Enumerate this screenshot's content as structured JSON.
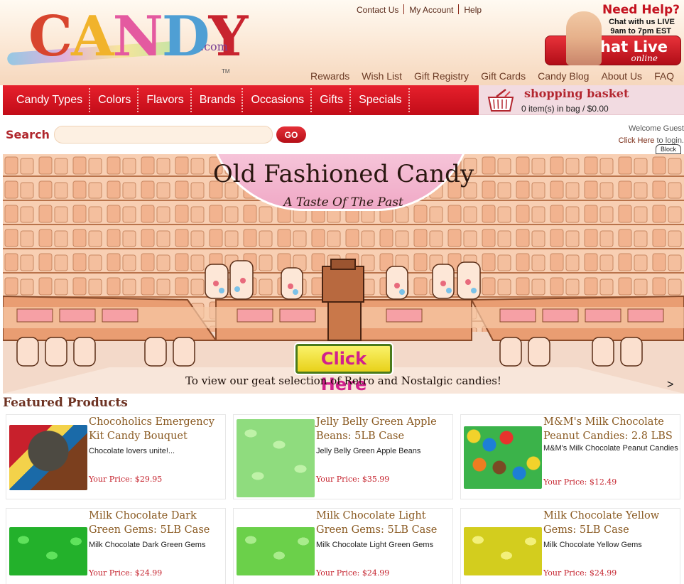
{
  "logo": {
    "wordmark": "CANDY",
    "tld": ".com",
    "tm": "TM"
  },
  "top_links": [
    "Contact Us",
    "My Account",
    "Help"
  ],
  "secondary_links": [
    "Rewards",
    "Wish List",
    "Gift Registry",
    "Gift Cards",
    "Candy Blog",
    "About Us",
    "FAQ"
  ],
  "help": {
    "title": "Need Help?",
    "line1": "Chat with us LIVE",
    "line2": "9am to 7pm EST",
    "button_title": "Chat Live",
    "button_sub": "online"
  },
  "nav": [
    "Candy Types",
    "Colors",
    "Flavors",
    "Brands",
    "Occasions",
    "Gifts",
    "Specials"
  ],
  "basket": {
    "title": "shopping basket",
    "status": "0 item(s) in bag / $0.00"
  },
  "search": {
    "label": "Search",
    "placeholder": "",
    "button": "GO"
  },
  "welcome": {
    "greeting": "Welcome Guest",
    "link_text": "Click Here",
    "suffix": " to login."
  },
  "block_label": "Block",
  "banner": {
    "title": "Old Fashioned Candy",
    "subtitle": "A Taste Of The Past",
    "button": "Click Here",
    "caption": "To view our geat selection of Retro and Nostalgic candies!",
    "next_glyph": ">"
  },
  "featured": {
    "title": "Featured Products",
    "products": [
      {
        "name": "Chocoholics Emergency Kit Candy Bouquet",
        "desc": "Chocolate lovers unite!...",
        "price": "Your Price: $29.95",
        "color": "#4d4a42"
      },
      {
        "name": "Jelly Belly Green Apple Beans: 5LB Case",
        "desc": "Jelly Belly Green Apple Beans",
        "price": "Your Price: $35.99",
        "color": "#8fdc7e"
      },
      {
        "name": "M&M's Milk Chocolate Peanut Candies: 2.8 LBS",
        "desc": "M&M's Milk Chocolate Peanut Candies",
        "price": "Your Price: $12.49",
        "color": "#e8332d"
      },
      {
        "name": "Milk Chocolate Dark Green Gems: 5LB Case",
        "desc": "Milk Chocolate Dark Green Gems",
        "price": "Your Price: $24.99",
        "color": "#23b12b"
      },
      {
        "name": "Milk Chocolate Light Green Gems: 5LB Case",
        "desc": "Milk Chocolate Light Green Gems",
        "price": "Your Price: $24.99",
        "color": "#6bd04a"
      },
      {
        "name": "Milk Chocolate Yellow Gems: 5LB Case",
        "desc": "Milk Chocolate Yellow Gems",
        "price": "Your Price: $24.99",
        "color": "#e3de2a"
      }
    ]
  },
  "colors": {
    "nav_red": "#d4141f",
    "brand_red": "#c4121f",
    "price_red": "#c41f2a",
    "product_brown": "#8a5a22"
  }
}
